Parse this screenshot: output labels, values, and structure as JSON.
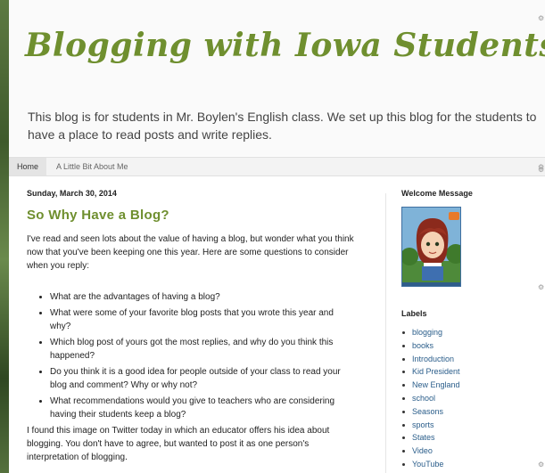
{
  "header": {
    "title": "Blogging with Iowa Students",
    "description": "This blog is for students in Mr. Boylen's English class. We set up this blog for the students to have a place to read posts and write replies."
  },
  "tabs": [
    {
      "label": "Home",
      "active": true
    },
    {
      "label": "A Little Bit About Me",
      "active": false
    }
  ],
  "post": {
    "date": "Sunday, March 30, 2014",
    "title": "So Why Have a Blog?",
    "intro": "I've read and seen lots about the value of having a blog, but wonder what you think now that you've been keeping one this year. Here are some questions to consider when you reply:",
    "questions": [
      "What are the advantages of having a blog?",
      "What were some of your favorite blog posts that you wrote this year and why?",
      "Which blog post of yours got the most replies, and why do you think this happened?",
      "Do you think it is a good idea for people outside of your class to read your blog and comment? Why or why not?",
      "What recommendations would you give to teachers who are considering having their students keep a blog?"
    ],
    "outro": "I found this image on Twitter today in which an educator offers his idea about blogging. You don't have to agree, but wanted to post it as one person's interpretation of blogging."
  },
  "sidebar": {
    "welcome_title": "Welcome Message",
    "labels_title": "Labels",
    "labels": [
      "blogging",
      "books",
      "Introduction",
      "Kid President",
      "New England",
      "school",
      "Seasons",
      "sports",
      "States",
      "Video",
      "YouTube"
    ]
  },
  "colors": {
    "title_green": "#6f8f2f",
    "link_blue": "#2a5d8a",
    "background_green": "#4e6a3a"
  },
  "icons": {
    "edge_widget_icon": "wrench-icon"
  }
}
